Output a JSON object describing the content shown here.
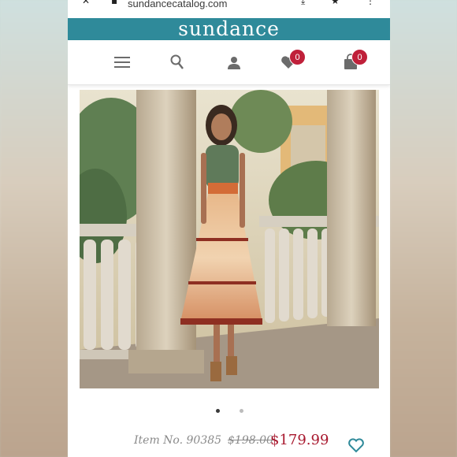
{
  "browser": {
    "url": "sundancecatalog.com"
  },
  "site": {
    "logo": "sundance",
    "brand_color": "#2f8a9a"
  },
  "nav": {
    "menu_icon": "hamburger-menu-icon",
    "search_icon": "search-icon",
    "account_icon": "user-icon",
    "wishlist_icon": "heart-icon",
    "wishlist_count": "0",
    "cart_icon": "shopping-bag-icon",
    "cart_count": "0",
    "badge_color": "#c0203a"
  },
  "product": {
    "image_alt": "Woman wearing a patterned tiered midi dress on a terrace",
    "carousel": {
      "total": 2,
      "active": 1
    },
    "item_number": "Item No. 90385",
    "original_price": "$198.00",
    "sale_price": "$179.99",
    "sale_color": "#a8182e",
    "wishlist_icon": "heart-outline-icon"
  }
}
